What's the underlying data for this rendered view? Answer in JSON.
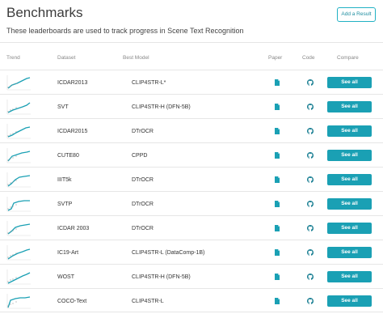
{
  "page": {
    "title": "Benchmarks",
    "subtitle": "These leaderboards are used to track progress in Scene Text Recognition",
    "add_button": "Add a Result"
  },
  "columns": {
    "trend": "Trend",
    "dataset": "Dataset",
    "best_model": "Best Model",
    "paper": "Paper",
    "code": "Code",
    "compare": "Compare"
  },
  "icons": {
    "paper": "paper-file-icon",
    "code": "github-icon"
  },
  "colors": {
    "accent": "#1aa0b4",
    "trend_line": "#1aa0b4"
  },
  "rows": [
    {
      "dataset": "ICDAR2013",
      "model": "CLIP4STR-L*",
      "compare": "See all"
    },
    {
      "dataset": "SVT",
      "model": "CLIP4STR-H (DFN-5B)",
      "compare": "See all"
    },
    {
      "dataset": "ICDAR2015",
      "model": "DTrOCR",
      "compare": "See all"
    },
    {
      "dataset": "CUTE80",
      "model": "CPPD",
      "compare": "See all"
    },
    {
      "dataset": "IIIT5k",
      "model": "DTrOCR",
      "compare": "See all"
    },
    {
      "dataset": "SVTP",
      "model": "DTrOCR",
      "compare": "See all"
    },
    {
      "dataset": "ICDAR 2003",
      "model": "DTrOCR",
      "compare": "See all"
    },
    {
      "dataset": "IC19-Art",
      "model": "CLIP4STR-L (DataComp-1B)",
      "compare": "See all"
    },
    {
      "dataset": "WOST",
      "model": "CLIP4STR-H (DFN-5B)",
      "compare": "See all"
    },
    {
      "dataset": "COCO-Text",
      "model": "CLIP4STR-L",
      "compare": "See all"
    }
  ]
}
